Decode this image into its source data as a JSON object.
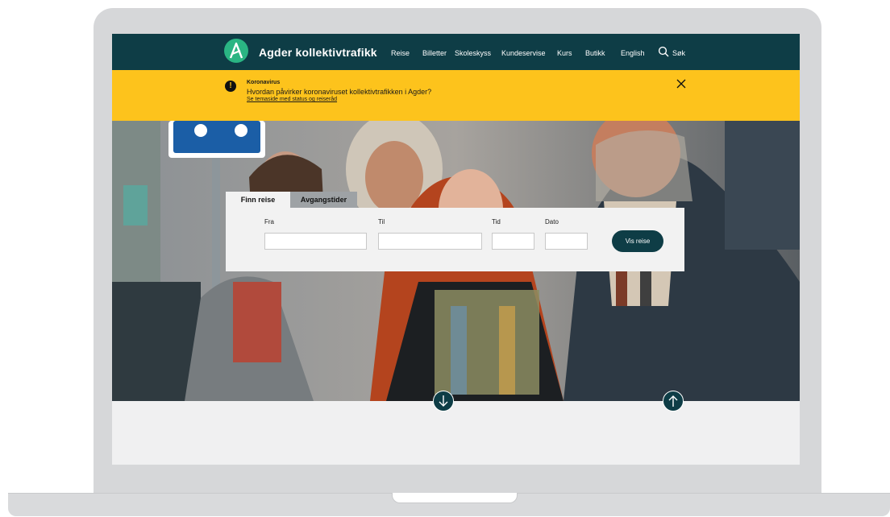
{
  "header": {
    "brand": "Agder kollektivtrafikk",
    "nav": [
      "Reise",
      "Billetter",
      "Skoleskyss",
      "Kundeservise",
      "Kurs",
      "Butikk",
      "English"
    ],
    "search_label": "Søk"
  },
  "alert": {
    "title": "Koronavirus",
    "text": "Hvordan påvirker koronaviruset kollektivtrafikken i Agder?",
    "link": "Se temaside med status og reiseråd"
  },
  "search_widget": {
    "tabs": [
      "Finn reise",
      "Avgangstider"
    ],
    "active_tab": "Finn reise",
    "fields": {
      "from_label": "Fra",
      "to_label": "Til",
      "time_label": "Tid",
      "date_label": "Dato"
    },
    "submit_label": "Vis reise"
  },
  "icons": {
    "logo": "agder-logo-icon",
    "search": "search-icon",
    "alert": "exclamation-icon",
    "close": "close-icon",
    "down": "arrow-down-icon",
    "up": "arrow-up-icon"
  },
  "colors": {
    "primary": "#0e3d46",
    "brand_green": "#2ab583",
    "alert_yellow": "#fdc31c"
  }
}
